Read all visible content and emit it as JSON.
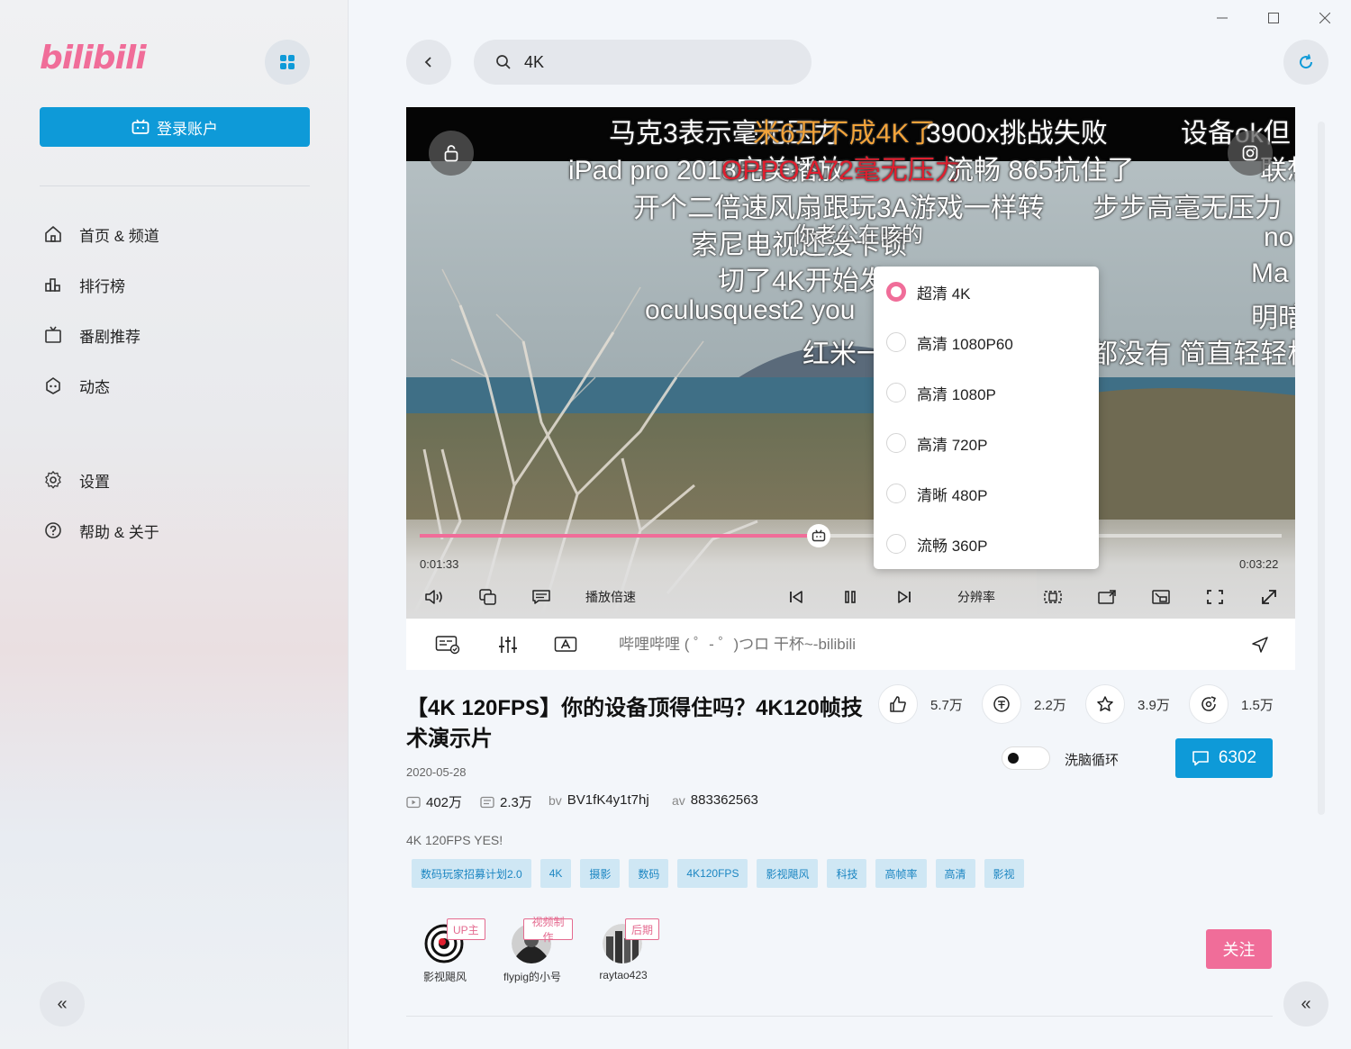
{
  "app": {
    "logo": "bilibili"
  },
  "sidebar": {
    "login_label": "登录账户",
    "items": [
      {
        "label": "首页 & 频道",
        "icon": "home-icon"
      },
      {
        "label": "排行榜",
        "icon": "ranking-icon"
      },
      {
        "label": "番剧推荐",
        "icon": "tv-icon"
      },
      {
        "label": "动态",
        "icon": "dynamic-icon"
      },
      {
        "label": "设置",
        "icon": "gear-icon"
      },
      {
        "label": "帮助 & 关于",
        "icon": "help-icon"
      }
    ],
    "collapse_label": "«"
  },
  "search": {
    "value": "4K"
  },
  "player": {
    "current_time": "0:01:33",
    "total_time": "0:03:22",
    "progress": 0.4624,
    "speed_label": "播放倍速",
    "resolution_label": "分辨率",
    "danmaku": [
      "马克3表示毫无压力",
      "米6开不成4K了",
      "3900x挑战失败",
      "设备ok但",
      "iPad pro 2018完美播放",
      "OPPO A72毫无压力",
      "流畅   865抗住了",
      "联想",
      "开个二倍速风扇跟玩3A游戏一样转",
      "步步高毫无压力",
      "索尼电视还没卡顿",
      "你老公在咳的",
      "no",
      "切了4K开始发",
      "Ma",
      "oculusquest2 you",
      "明暗",
      "红米一",
      "都没有 简直轻轻松"
    ],
    "quality_options": [
      {
        "label": "超清 4K",
        "selected": true
      },
      {
        "label": "高清 1080P60",
        "selected": false
      },
      {
        "label": "高清 1080P",
        "selected": false
      },
      {
        "label": "高清 720P",
        "selected": false
      },
      {
        "label": "清晰 480P",
        "selected": false
      },
      {
        "label": "流畅 360P",
        "selected": false
      }
    ]
  },
  "danmaku_bar": {
    "placeholder": "哔哩哔哩 ( ゜- ゜)つロ 干杯~-bilibili"
  },
  "video": {
    "title": "【4K 120FPS】你的设备顶得住吗？4K120帧技术演示片",
    "date": "2020-05-28",
    "views": "402万",
    "danmaku_count": "2.3万",
    "bv_label": "bv",
    "bv": "BV1fK4y1t7hj",
    "av_label": "av",
    "av": "883362563",
    "description": "4K 120FPS YES!",
    "stats": {
      "likes": "5.7万",
      "coins": "2.2万",
      "favorites": "3.9万",
      "shares": "1.5万"
    },
    "loop_label": "洗脑循环",
    "comments": "6302",
    "tags": [
      "数码玩家招募计划2.0",
      "4K",
      "摄影",
      "数码",
      "4K120FPS",
      "影视飓风",
      "科技",
      "高帧率",
      "高清",
      "影视"
    ],
    "creators": [
      {
        "name": "影视飓风",
        "role": "UP主"
      },
      {
        "name": "flypig的小号",
        "role": "视频制作"
      },
      {
        "name": "raytao423",
        "role": "后期"
      }
    ],
    "follow_label": "关注"
  },
  "colors": {
    "accent": "#0e9ad8",
    "pink": "#f06d99"
  }
}
